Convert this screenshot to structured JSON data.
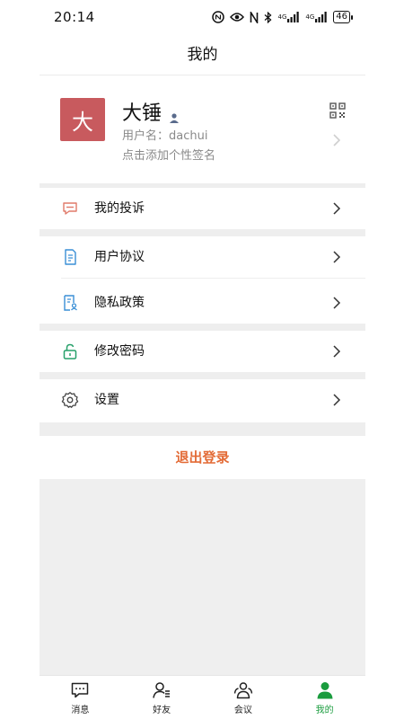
{
  "status_bar": {
    "time": "20:14",
    "network_1": "4G",
    "network_2": "4G",
    "battery": "46"
  },
  "page": {
    "title": "我的"
  },
  "profile": {
    "avatar_char": "大",
    "avatar_color": "#c85a5e",
    "display_name": "大锤",
    "username": "用户名：dachui",
    "signature_placeholder": "点击添加个性签名"
  },
  "menu": {
    "complaints": "我的投诉",
    "user_agreement": "用户协议",
    "privacy_policy": "隐私政策",
    "change_password": "修改密码",
    "settings": "设置"
  },
  "logout": {
    "label": "退出登录",
    "color": "#e36b36"
  },
  "tabbar": {
    "active_color": "#1a9c3e",
    "tabs": [
      {
        "label": "消息",
        "icon": "message-icon"
      },
      {
        "label": "好友",
        "icon": "friends-icon"
      },
      {
        "label": "会议",
        "icon": "meeting-icon"
      },
      {
        "label": "我的",
        "icon": "me-icon"
      }
    ]
  }
}
